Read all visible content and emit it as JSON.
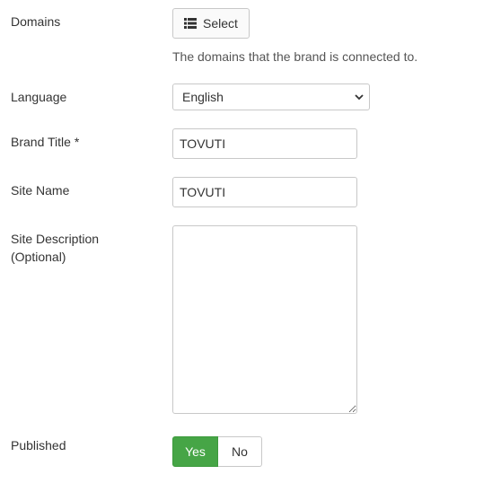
{
  "form": {
    "domains": {
      "label": "Domains",
      "button_label": "Select",
      "button_icon": "list-icon",
      "help": "The domains that the brand is connected to."
    },
    "language": {
      "label": "Language",
      "selected": "English"
    },
    "brand_title": {
      "label": "Brand Title *",
      "value": "TOVUTI"
    },
    "site_name": {
      "label": "Site Name",
      "value": "TOVUTI"
    },
    "site_description": {
      "label_line1": "Site Description",
      "label_line2": "(Optional)",
      "value": ""
    },
    "published": {
      "label": "Published",
      "yes": "Yes",
      "no": "No",
      "selected": "Yes"
    }
  },
  "colors": {
    "yes_active": "#46a546",
    "border": "#c8c8c8",
    "text": "#333333"
  }
}
